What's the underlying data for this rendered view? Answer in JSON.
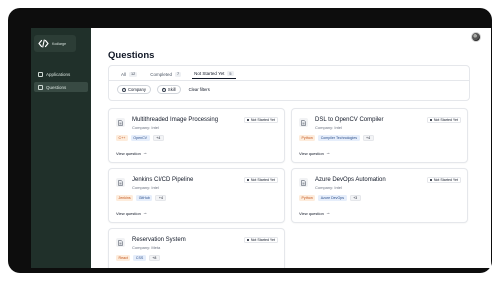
{
  "sidebar": {
    "brand": {
      "label": "Kodlarge"
    },
    "items": [
      {
        "label": "Applications",
        "icon": "document-icon",
        "active": false
      },
      {
        "label": "Questions",
        "icon": "list-icon",
        "active": true
      }
    ]
  },
  "main": {
    "title": "Questions",
    "tabs": [
      {
        "label": "All",
        "count": "12"
      },
      {
        "label": "Completed",
        "count": "7"
      },
      {
        "label": "Not Started Yet",
        "count": "5"
      }
    ],
    "filters": {
      "company": "Company",
      "skill": "Skill",
      "clear": "Clear filters"
    },
    "view_label": "View question",
    "cards": [
      {
        "title": "Multithreaded Image Processing",
        "company": "Company: Intel",
        "status": "Not Started Yet",
        "skills": [
          {
            "label": "C++",
            "tone": "orange"
          },
          {
            "label": "OpenCV",
            "tone": "blue"
          }
        ],
        "more": "+4"
      },
      {
        "title": "DSL to OpenCV Compiler",
        "company": "Company: Intel",
        "status": "Not Started Yet",
        "skills": [
          {
            "label": "Python",
            "tone": "orange"
          },
          {
            "label": "Compiler Technologies",
            "tone": "blue"
          }
        ],
        "more": "+4"
      },
      {
        "title": "Jenkins CI/CD Pipeline",
        "company": "Company: Intel",
        "status": "Not Started Yet",
        "skills": [
          {
            "label": "Jenkins",
            "tone": "orange"
          },
          {
            "label": "GitHub",
            "tone": "blue"
          }
        ],
        "more": "+4"
      },
      {
        "title": "Azure DevOps Automation",
        "company": "Company: Intel",
        "status": "Not Started Yet",
        "skills": [
          {
            "label": "Python",
            "tone": "orange"
          },
          {
            "label": "Azure DevOps",
            "tone": "blue"
          }
        ],
        "more": "+3"
      },
      {
        "title": "Reservation System",
        "company": "Company: Meta",
        "status": "Not Started Yet",
        "skills": [
          {
            "label": "React",
            "tone": "orange"
          },
          {
            "label": "CSS",
            "tone": "blue"
          }
        ],
        "more": "+8"
      }
    ]
  },
  "colors": {
    "sidebar_bg": "#20302a",
    "device_bezel": "#0d0d0d",
    "tag_orange_bg": "#fdecdc",
    "tag_orange_text": "#c2541b",
    "tag_blue_bg": "#e6eefb",
    "tag_blue_text": "#2c4f8a"
  }
}
